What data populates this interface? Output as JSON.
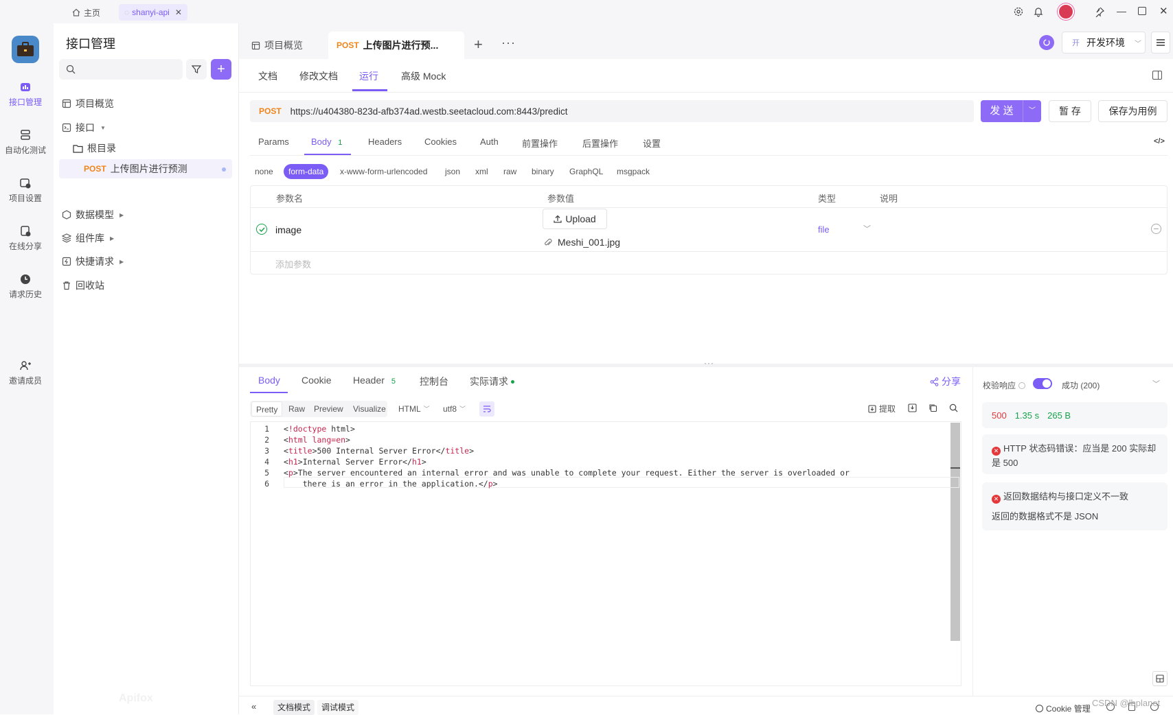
{
  "topbar": {
    "home_label": "主页",
    "project_tab": "shanyi-api"
  },
  "rail": {
    "items": [
      {
        "label": "接口管理",
        "icon": "api-icon",
        "active": true
      },
      {
        "label": "自动化测试",
        "icon": "automation-icon"
      },
      {
        "label": "项目设置",
        "icon": "project-settings-icon"
      },
      {
        "label": "在线分享",
        "icon": "share-online-icon"
      },
      {
        "label": "请求历史",
        "icon": "history-icon"
      },
      {
        "label": "邀请成员",
        "icon": "invite-member-icon"
      }
    ]
  },
  "tree": {
    "title": "接口管理",
    "search_placeholder": "",
    "items": [
      {
        "label": "项目概览",
        "icon": "overview-icon"
      },
      {
        "label": "接口",
        "icon": "api-folder-icon"
      },
      {
        "label": "根目录",
        "icon": "folder-icon"
      },
      {
        "method": "POST",
        "label": "上传图片进行预测"
      },
      {
        "label": "数据模型",
        "icon": "data-model-icon"
      },
      {
        "label": "组件库",
        "icon": "component-icon"
      },
      {
        "label": "快捷请求",
        "icon": "quick-request-icon"
      },
      {
        "label": "回收站",
        "icon": "trash-icon"
      }
    ],
    "watermark": "Apifox"
  },
  "tabs": {
    "overview": "项目概览",
    "active_method": "POST",
    "active_label": "上传图片进行预..."
  },
  "env": {
    "prefix": "开",
    "label": "开发环境"
  },
  "subtabs": [
    "文档",
    "修改文档",
    "运行",
    "高级 Mock"
  ],
  "request": {
    "method": "POST",
    "url": "https://u404380-823d-afb374ad.westb.seetacloud.com:8443/predict",
    "send": "发 送",
    "save_temp": "暂 存",
    "save_case": "保存为用例"
  },
  "param_tabs": [
    "Params",
    "Body",
    "Headers",
    "Cookies",
    "Auth",
    "前置操作",
    "后置操作",
    "设置"
  ],
  "body_count": "1",
  "body_types": [
    "none",
    "form-data",
    "x-www-form-urlencoded",
    "json",
    "xml",
    "raw",
    "binary",
    "GraphQL",
    "msgpack"
  ],
  "form_table": {
    "headers": [
      "参数名",
      "参数值",
      "类型",
      "说明"
    ],
    "row": {
      "name": "image",
      "upload": "Upload",
      "file": "Meshi_001.jpg",
      "type": "file"
    },
    "add_placeholder": "添加参数"
  },
  "response": {
    "tabs": [
      "Body",
      "Cookie",
      "Header",
      "控制台",
      "实际请求"
    ],
    "header_count": "5",
    "share": "分享",
    "formats": [
      "Pretty",
      "Raw",
      "Preview",
      "Visualize"
    ],
    "lang": "HTML",
    "encoding": "utf8",
    "extract": "提取",
    "code": [
      "<!doctype html>",
      "<html lang=en>",
      "<title>500 Internal Server Error</title>",
      "<h1>Internal Server Error</h1>",
      "<p>The server encountered an internal error and was unable to complete your request. Either the server is overloaded or",
      "    there is an error in the application.</p>"
    ]
  },
  "validation": {
    "label": "校验响应",
    "status_select": "成功 (200)",
    "status_code": "500",
    "time": "1.35 s",
    "size": "265 B",
    "error1": "HTTP 状态码错误：应当是 200 实际却是 500",
    "error2": "返回数据结构与接口定义不一致",
    "error2_detail": "返回的数据格式不是 JSON"
  },
  "footer": {
    "doc_mode": "文档模式",
    "debug_mode": "调试模式",
    "cookie": "Cookie 管理",
    "watermark": "CSDN @lbplanet"
  },
  "colors": {
    "accent": "#7b5cf5",
    "post": "#f0851a",
    "error": "#e5383b",
    "success": "#16a34a"
  }
}
